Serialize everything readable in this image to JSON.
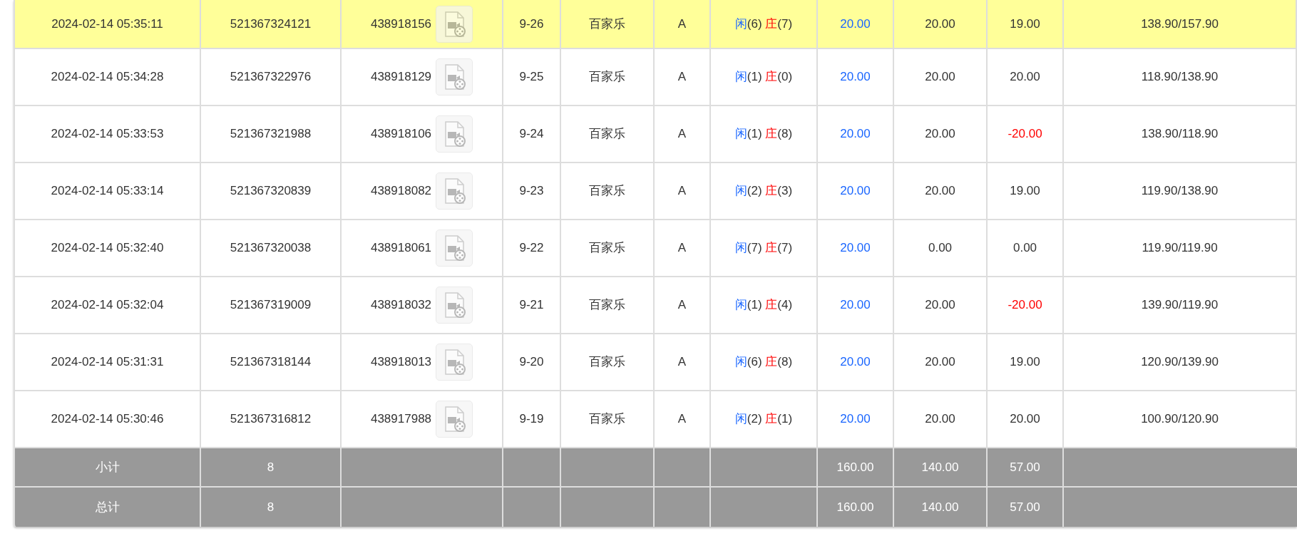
{
  "rows": [
    {
      "time": "2024-02-14 05:35:11",
      "order_no": "521367324121",
      "round_no": "438918156",
      "table": "9-26",
      "game": "百家乐",
      "table_type": "A",
      "result": {
        "player": "闲",
        "player_points": "(6)",
        "banker": "庄",
        "banker_points": "(7)"
      },
      "bet": "20.00",
      "valid_bet": "20.00",
      "win_loss": "19.00",
      "negative": false,
      "balance": "138.90/157.90",
      "selected": true
    },
    {
      "time": "2024-02-14 05:34:28",
      "order_no": "521367322976",
      "round_no": "438918129",
      "table": "9-25",
      "game": "百家乐",
      "table_type": "A",
      "result": {
        "player": "闲",
        "player_points": "(1)",
        "banker": "庄",
        "banker_points": "(0)"
      },
      "bet": "20.00",
      "valid_bet": "20.00",
      "win_loss": "20.00",
      "negative": false,
      "balance": "118.90/138.90",
      "selected": false
    },
    {
      "time": "2024-02-14 05:33:53",
      "order_no": "521367321988",
      "round_no": "438918106",
      "table": "9-24",
      "game": "百家乐",
      "table_type": "A",
      "result": {
        "player": "闲",
        "player_points": "(1)",
        "banker": "庄",
        "banker_points": "(8)"
      },
      "bet": "20.00",
      "valid_bet": "20.00",
      "win_loss": "-20.00",
      "negative": true,
      "balance": "138.90/118.90",
      "selected": false
    },
    {
      "time": "2024-02-14 05:33:14",
      "order_no": "521367320839",
      "round_no": "438918082",
      "table": "9-23",
      "game": "百家乐",
      "table_type": "A",
      "result": {
        "player": "闲",
        "player_points": "(2)",
        "banker": "庄",
        "banker_points": "(3)"
      },
      "bet": "20.00",
      "valid_bet": "20.00",
      "win_loss": "19.00",
      "negative": false,
      "balance": "119.90/138.90",
      "selected": false
    },
    {
      "time": "2024-02-14 05:32:40",
      "order_no": "521367320038",
      "round_no": "438918061",
      "table": "9-22",
      "game": "百家乐",
      "table_type": "A",
      "result": {
        "player": "闲",
        "player_points": "(7)",
        "banker": "庄",
        "banker_points": "(7)"
      },
      "bet": "20.00",
      "valid_bet": "0.00",
      "win_loss": "0.00",
      "negative": false,
      "balance": "119.90/119.90",
      "selected": false
    },
    {
      "time": "2024-02-14 05:32:04",
      "order_no": "521367319009",
      "round_no": "438918032",
      "table": "9-21",
      "game": "百家乐",
      "table_type": "A",
      "result": {
        "player": "闲",
        "player_points": "(1)",
        "banker": "庄",
        "banker_points": "(4)"
      },
      "bet": "20.00",
      "valid_bet": "20.00",
      "win_loss": "-20.00",
      "negative": true,
      "balance": "139.90/119.90",
      "selected": false
    },
    {
      "time": "2024-02-14 05:31:31",
      "order_no": "521367318144",
      "round_no": "438918013",
      "table": "9-20",
      "game": "百家乐",
      "table_type": "A",
      "result": {
        "player": "闲",
        "player_points": "(6)",
        "banker": "庄",
        "banker_points": "(8)"
      },
      "bet": "20.00",
      "valid_bet": "20.00",
      "win_loss": "19.00",
      "negative": false,
      "balance": "120.90/139.90",
      "selected": false
    },
    {
      "time": "2024-02-14 05:30:46",
      "order_no": "521367316812",
      "round_no": "438917988",
      "table": "9-19",
      "game": "百家乐",
      "table_type": "A",
      "result": {
        "player": "闲",
        "player_points": "(2)",
        "banker": "庄",
        "banker_points": "(1)"
      },
      "bet": "20.00",
      "valid_bet": "20.00",
      "win_loss": "20.00",
      "negative": false,
      "balance": "100.90/120.90",
      "selected": false
    }
  ],
  "totals": [
    {
      "label": "小计",
      "count": "8",
      "bet": "160.00",
      "valid_bet": "140.00",
      "win_loss": "57.00"
    },
    {
      "label": "总计",
      "count": "8",
      "bet": "160.00",
      "valid_bet": "140.00",
      "win_loss": "57.00"
    }
  ]
}
